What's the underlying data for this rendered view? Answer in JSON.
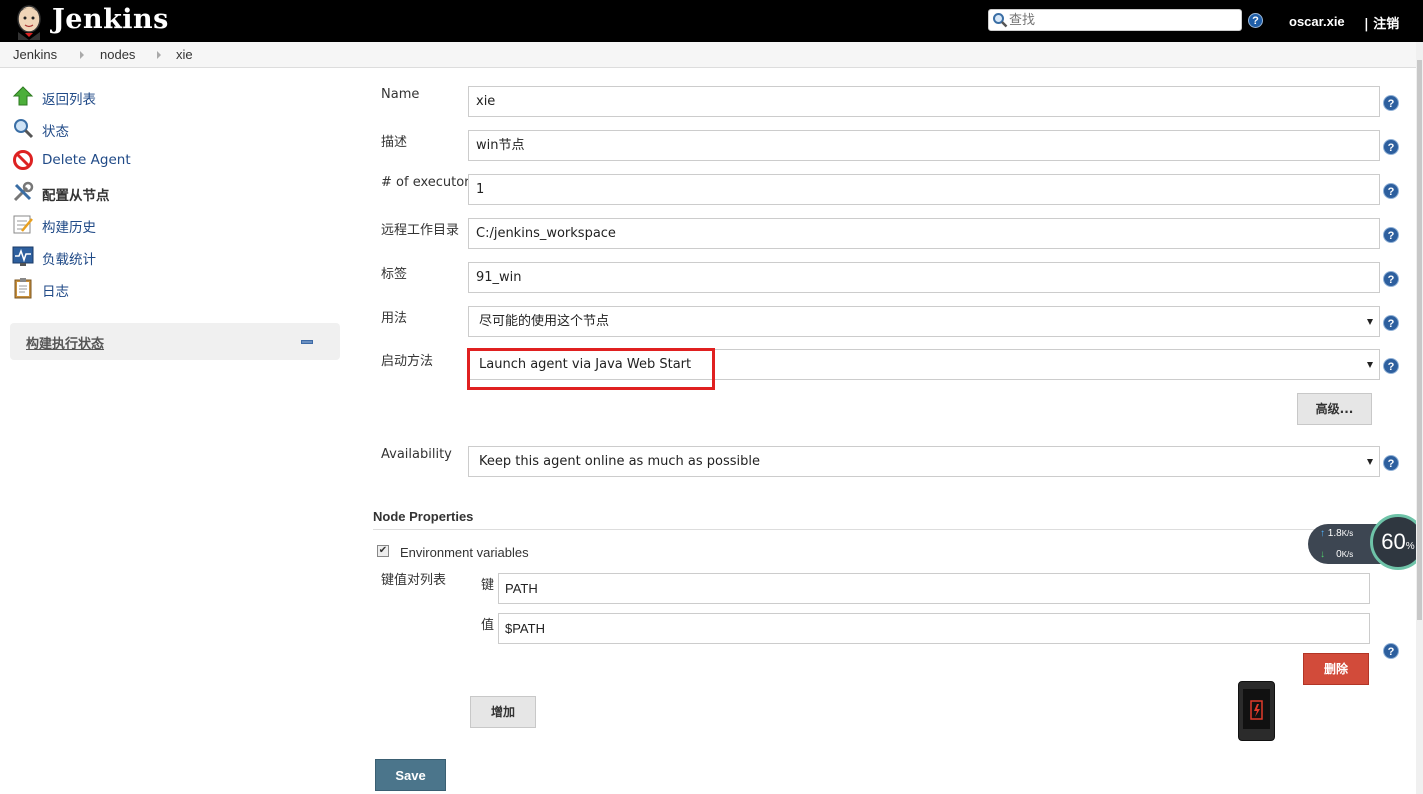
{
  "header": {
    "brand": "Jenkins",
    "search_placeholder": "查找",
    "help_glyph": "?",
    "user": "oscar.xie",
    "logout": "| 注销"
  },
  "breadcrumb": [
    "Jenkins",
    "nodes",
    "xie"
  ],
  "sidebar": {
    "items": [
      {
        "label": "返回列表",
        "icon": "up-arrow-icon"
      },
      {
        "label": "状态",
        "icon": "magnifier-icon"
      },
      {
        "label": "Delete Agent",
        "icon": "no-entry-icon"
      },
      {
        "label": "配置从节点",
        "icon": "tools-icon"
      },
      {
        "label": "构建历史",
        "icon": "notepad-icon"
      },
      {
        "label": "负载统计",
        "icon": "monitor-icon"
      },
      {
        "label": "日志",
        "icon": "clipboard-icon"
      }
    ],
    "executor_status": "构建执行状态"
  },
  "form": {
    "name_label": "Name",
    "name_value": "xie",
    "desc_label": "描述",
    "desc_value": "win节点",
    "executors_label": "# of executors",
    "executors_value": "1",
    "workdir_label": "远程工作目录",
    "workdir_value": "C:/jenkins_workspace",
    "labels_label": "标签",
    "labels_value": "91_win",
    "usage_label": "用法",
    "usage_value": "尽可能的使用这个节点",
    "launch_label": "启动方法",
    "launch_value": "Launch agent via Java Web Start",
    "advanced_button": "高级...",
    "availability_label": "Availability",
    "availability_value": "Keep this agent online as much as possible"
  },
  "node_properties": {
    "title": "Node Properties",
    "env_checkbox_label": "Environment variables",
    "env_checked": true,
    "kv_list_label": "键值对列表",
    "key_label": "键",
    "key_value": "PATH",
    "value_label": "值",
    "value_value": "$PATH",
    "delete_button": "删除",
    "add_button": "增加"
  },
  "save_button": "Save",
  "net_monitor": {
    "up_speed": "1.8",
    "down_speed": "0",
    "unit": "K/s",
    "percent": "60",
    "percent_sign": "%"
  },
  "colors": {
    "header_bg": "#000000",
    "highlight_border": "#e02020",
    "delete_button": "#d24b3a",
    "save_button": "#4b758b"
  }
}
